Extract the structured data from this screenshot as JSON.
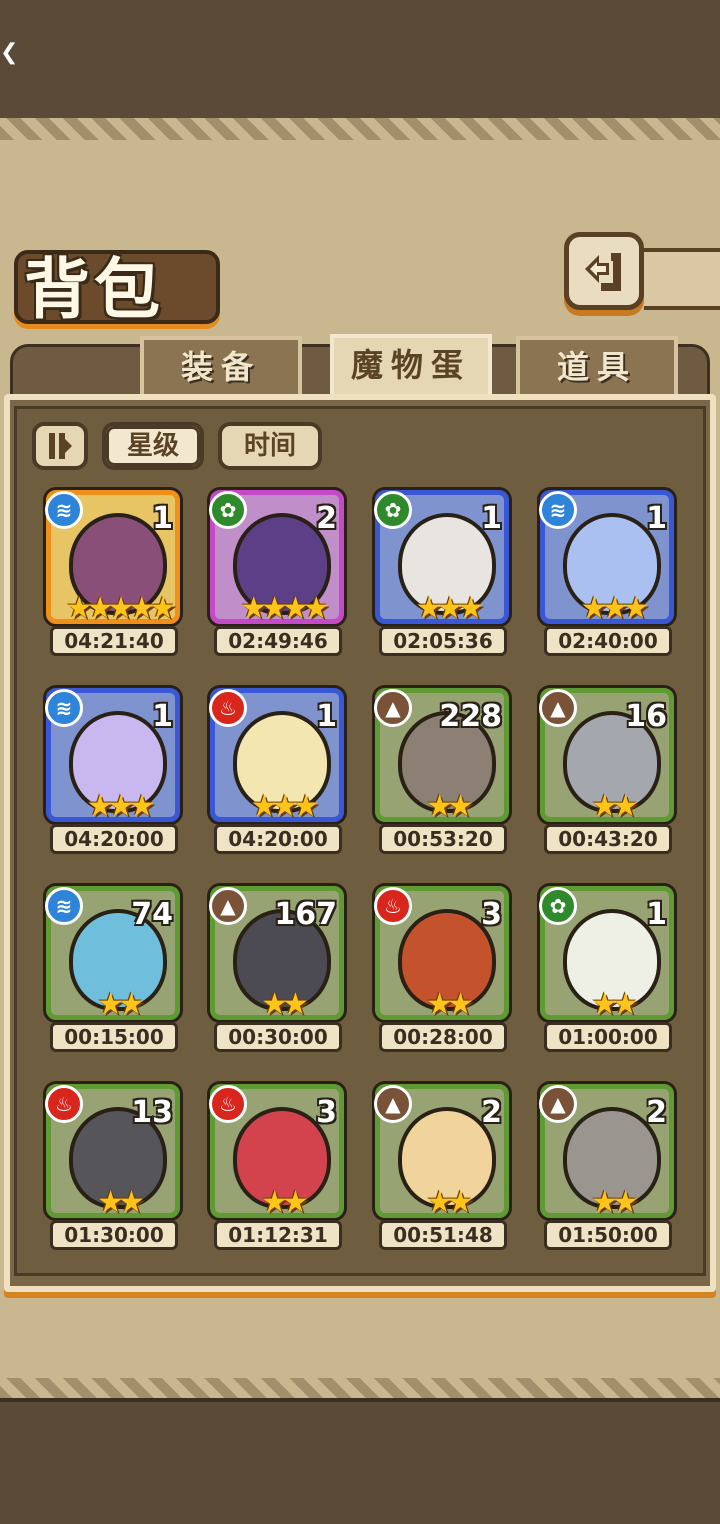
{
  "header": {
    "title": "背包"
  },
  "tabs": [
    {
      "label": "装备",
      "active": false
    },
    {
      "label": "魔物蛋",
      "active": true
    },
    {
      "label": "道具",
      "active": false
    }
  ],
  "sort": {
    "star_label": "星级",
    "time_label": "时间",
    "active": "星级"
  },
  "colors": {
    "water": "#2d84d8",
    "grass": "#2f8a2c",
    "fire": "#d8261d",
    "earth": "#7a5238",
    "star": "#ffc41a"
  },
  "eggs": [
    {
      "element": "water",
      "count": "1",
      "stars": 5,
      "timer": "04:21:40",
      "rarity": "gold",
      "color": "#8a4f78"
    },
    {
      "element": "grass",
      "count": "2",
      "stars": 4,
      "timer": "02:49:46",
      "rarity": "purple",
      "color": "#5c3f86"
    },
    {
      "element": "grass",
      "count": "1",
      "stars": 3,
      "timer": "02:05:36",
      "rarity": "blue",
      "color": "#e8e4df"
    },
    {
      "element": "water",
      "count": "1",
      "stars": 3,
      "timer": "02:40:00",
      "rarity": "blue",
      "color": "#aac0f0"
    },
    {
      "element": "water",
      "count": "1",
      "stars": 3,
      "timer": "04:20:00",
      "rarity": "blue",
      "color": "#c9b7ef"
    },
    {
      "element": "fire",
      "count": "1",
      "stars": 3,
      "timer": "04:20:00",
      "rarity": "blue",
      "color": "#f4e6b0"
    },
    {
      "element": "earth",
      "count": "228",
      "stars": 2,
      "timer": "00:53:20",
      "rarity": "green",
      "color": "#8c8074"
    },
    {
      "element": "earth",
      "count": "16",
      "stars": 2,
      "timer": "00:43:20",
      "rarity": "green",
      "color": "#a4a8ae"
    },
    {
      "element": "water",
      "count": "74",
      "stars": 2,
      "timer": "00:15:00",
      "rarity": "green",
      "color": "#6fbfdc"
    },
    {
      "element": "earth",
      "count": "167",
      "stars": 2,
      "timer": "00:30:00",
      "rarity": "green",
      "color": "#4c4a52"
    },
    {
      "element": "fire",
      "count": "3",
      "stars": 2,
      "timer": "00:28:00",
      "rarity": "green",
      "color": "#c4532d"
    },
    {
      "element": "grass",
      "count": "1",
      "stars": 2,
      "timer": "01:00:00",
      "rarity": "green",
      "color": "#eef0e6"
    },
    {
      "element": "fire",
      "count": "13",
      "stars": 2,
      "timer": "01:30:00",
      "rarity": "green",
      "color": "#55555a"
    },
    {
      "element": "fire",
      "count": "3",
      "stars": 2,
      "timer": "01:12:31",
      "rarity": "green",
      "color": "#d2434e"
    },
    {
      "element": "earth",
      "count": "2",
      "stars": 2,
      "timer": "00:51:48",
      "rarity": "green",
      "color": "#f1d39c"
    },
    {
      "element": "earth",
      "count": "2",
      "stars": 2,
      "timer": "01:50:00",
      "rarity": "green",
      "color": "#9a958f"
    }
  ]
}
